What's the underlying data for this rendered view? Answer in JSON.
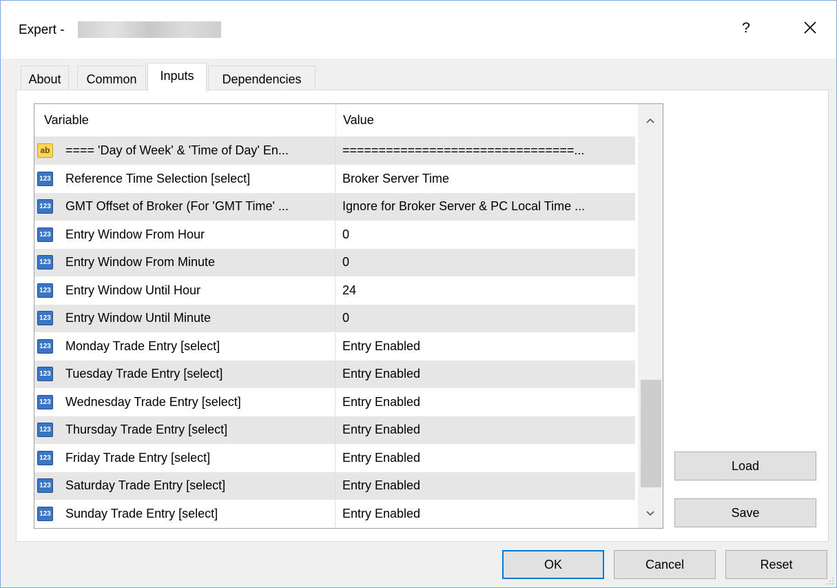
{
  "window": {
    "title": "Expert -",
    "help_label": "?",
    "close_icon": "close-icon"
  },
  "tabs": [
    {
      "label": "About"
    },
    {
      "label": "Common"
    },
    {
      "label": "Inputs",
      "active": true
    },
    {
      "label": "Dependencies"
    }
  ],
  "grid": {
    "columns": [
      "Variable",
      "Value"
    ],
    "rows": [
      {
        "icon": "string-type-icon",
        "icon_text": "ab",
        "variable": "==== 'Day of Week' & 'Time of Day' En...",
        "value": "================================..."
      },
      {
        "icon": "integer-type-icon",
        "icon_text": "123",
        "variable": "Reference Time Selection [select]",
        "value": "Broker Server Time"
      },
      {
        "icon": "integer-type-icon",
        "icon_text": "123",
        "variable": "GMT Offset of Broker (For 'GMT Time' ...",
        "value": "Ignore for Broker Server & PC Local Time ..."
      },
      {
        "icon": "integer-type-icon",
        "icon_text": "123",
        "variable": "Entry Window From Hour",
        "value": "0"
      },
      {
        "icon": "integer-type-icon",
        "icon_text": "123",
        "variable": "Entry Window From Minute",
        "value": "0"
      },
      {
        "icon": "integer-type-icon",
        "icon_text": "123",
        "variable": "Entry Window Until Hour",
        "value": "24"
      },
      {
        "icon": "integer-type-icon",
        "icon_text": "123",
        "variable": "Entry Window Until Minute",
        "value": "0"
      },
      {
        "icon": "integer-type-icon",
        "icon_text": "123",
        "variable": "Monday Trade Entry [select]",
        "value": "Entry Enabled"
      },
      {
        "icon": "integer-type-icon",
        "icon_text": "123",
        "variable": "Tuesday Trade Entry [select]",
        "value": "Entry Enabled"
      },
      {
        "icon": "integer-type-icon",
        "icon_text": "123",
        "variable": "Wednesday Trade Entry [select]",
        "value": "Entry Enabled"
      },
      {
        "icon": "integer-type-icon",
        "icon_text": "123",
        "variable": "Thursday Trade Entry [select]",
        "value": "Entry Enabled"
      },
      {
        "icon": "integer-type-icon",
        "icon_text": "123",
        "variable": "Friday Trade Entry [select]",
        "value": "Entry Enabled"
      },
      {
        "icon": "integer-type-icon",
        "icon_text": "123",
        "variable": "Saturday Trade Entry [select]",
        "value": "Entry Enabled"
      },
      {
        "icon": "integer-type-icon",
        "icon_text": "123",
        "variable": "Sunday Trade Entry [select]",
        "value": "Entry Enabled"
      }
    ]
  },
  "side_buttons": {
    "load_label": "Load",
    "save_label": "Save"
  },
  "footer_buttons": {
    "ok_label": "OK",
    "cancel_label": "Cancel",
    "reset_label": "Reset"
  },
  "colors": {
    "row_alt": "#e6e6e6",
    "accent": "#0078d7",
    "int_icon": "#3a76c4",
    "string_icon": "#f5d75b"
  }
}
